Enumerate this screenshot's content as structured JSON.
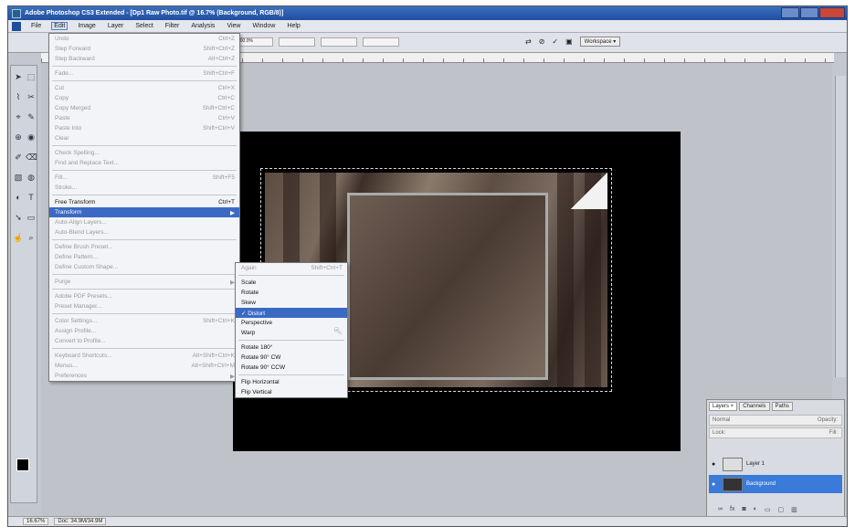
{
  "window": {
    "title": "Adobe Photoshop CS3 Extended - [Dp1 Raw Photo.tif @ 16.7% (Background, RGB/8)]"
  },
  "menubar": {
    "items": [
      "File",
      "Edit",
      "Image",
      "Layer",
      "Select",
      "Filter",
      "Analysis",
      "View",
      "Window",
      "Help"
    ],
    "active": "Edit"
  },
  "optionsbar": {
    "zoom": "100.0%",
    "workspace": "Workspace ▾"
  },
  "edit_menu": {
    "items": [
      {
        "label": "Undo",
        "shortcut": "Ctrl+Z",
        "enabled": false
      },
      {
        "label": "Step Forward",
        "shortcut": "Shift+Ctrl+Z",
        "enabled": false
      },
      {
        "label": "Step Backward",
        "shortcut": "Alt+Ctrl+Z",
        "enabled": false
      },
      {
        "sep": true
      },
      {
        "label": "Fade...",
        "shortcut": "Shift+Ctrl+F",
        "enabled": false
      },
      {
        "sep": true
      },
      {
        "label": "Cut",
        "shortcut": "Ctrl+X",
        "enabled": false
      },
      {
        "label": "Copy",
        "shortcut": "Ctrl+C",
        "enabled": false
      },
      {
        "label": "Copy Merged",
        "shortcut": "Shift+Ctrl+C",
        "enabled": false
      },
      {
        "label": "Paste",
        "shortcut": "Ctrl+V",
        "enabled": false
      },
      {
        "label": "Paste Into",
        "shortcut": "Shift+Ctrl+V",
        "enabled": false
      },
      {
        "label": "Clear",
        "shortcut": "",
        "enabled": false
      },
      {
        "sep": true
      },
      {
        "label": "Check Spelling...",
        "shortcut": "",
        "enabled": false
      },
      {
        "label": "Find and Replace Text...",
        "shortcut": "",
        "enabled": false
      },
      {
        "sep": true
      },
      {
        "label": "Fill...",
        "shortcut": "Shift+F5",
        "enabled": false
      },
      {
        "label": "Stroke...",
        "shortcut": "",
        "enabled": false
      },
      {
        "sep": true
      },
      {
        "label": "Free Transform",
        "shortcut": "Ctrl+T",
        "enabled": true
      },
      {
        "label": "Transform",
        "shortcut": "▶",
        "enabled": true,
        "selected": true
      },
      {
        "label": "Auto-Align Layers...",
        "shortcut": "",
        "enabled": false
      },
      {
        "label": "Auto-Blend Layers...",
        "shortcut": "",
        "enabled": false
      },
      {
        "sep": true
      },
      {
        "label": "Define Brush Preset...",
        "shortcut": "",
        "enabled": false
      },
      {
        "label": "Define Pattern...",
        "shortcut": "",
        "enabled": false
      },
      {
        "label": "Define Custom Shape...",
        "shortcut": "",
        "enabled": false
      },
      {
        "sep": true
      },
      {
        "label": "Purge",
        "shortcut": "▶",
        "enabled": false
      },
      {
        "sep": true
      },
      {
        "label": "Adobe PDF Presets...",
        "shortcut": "",
        "enabled": false
      },
      {
        "label": "Preset Manager...",
        "shortcut": "",
        "enabled": false
      },
      {
        "sep": true
      },
      {
        "label": "Color Settings...",
        "shortcut": "Shift+Ctrl+K",
        "enabled": false
      },
      {
        "label": "Assign Profile...",
        "shortcut": "",
        "enabled": false
      },
      {
        "label": "Convert to Profile...",
        "shortcut": "",
        "enabled": false
      },
      {
        "sep": true
      },
      {
        "label": "Keyboard Shortcuts...",
        "shortcut": "Alt+Shift+Ctrl+K",
        "enabled": false
      },
      {
        "label": "Menus...",
        "shortcut": "Alt+Shift+Ctrl+M",
        "enabled": false
      },
      {
        "label": "Preferences",
        "shortcut": "▶",
        "enabled": false
      }
    ]
  },
  "transform_menu": {
    "items": [
      {
        "label": "Again",
        "shortcut": "Shift+Ctrl+T",
        "enabled": false
      },
      {
        "sep": true
      },
      {
        "label": "Scale",
        "enabled": true
      },
      {
        "label": "Rotate",
        "enabled": true
      },
      {
        "label": "Skew",
        "enabled": true
      },
      {
        "label": "✓ Distort",
        "enabled": true,
        "selected": true
      },
      {
        "label": "Perspective",
        "enabled": true
      },
      {
        "label": "Warp",
        "enabled": true
      },
      {
        "sep": true
      },
      {
        "label": "Rotate 180°",
        "enabled": true
      },
      {
        "label": "Rotate 90° CW",
        "enabled": true
      },
      {
        "label": "Rotate 90° CCW",
        "enabled": true
      },
      {
        "sep": true
      },
      {
        "label": "Flip Horizontal",
        "enabled": true
      },
      {
        "label": "Flip Vertical",
        "enabled": true
      }
    ]
  },
  "layers_panel": {
    "tabs": [
      "Layers ×",
      "Channels",
      "Paths"
    ],
    "blend_mode": "Normal",
    "opacity": "Opacity:",
    "lock": "Lock:",
    "fill": "Fill:",
    "layers": [
      {
        "name": "Layer 1",
        "selected": false
      },
      {
        "name": "Background",
        "selected": true
      }
    ]
  },
  "statusbar": {
    "zoom": "16.67%",
    "doc": "Doc: 34.9M/34.9M"
  }
}
